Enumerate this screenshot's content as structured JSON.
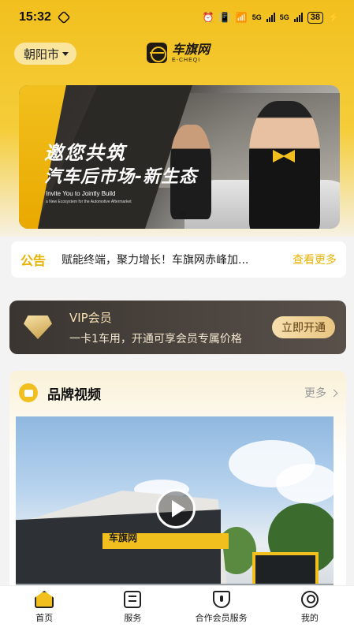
{
  "status_bar": {
    "time": "15:32",
    "network_5g_a": "5G",
    "network_5g_b": "5G",
    "battery": "38",
    "icons": [
      "alarm-icon",
      "vibrate-icon",
      "wifi-icon",
      "signal-icon",
      "signal-icon",
      "charging-icon"
    ]
  },
  "header": {
    "city": "朝阳市",
    "logo_cn": "车旗网",
    "logo_en": "E-CHEQI"
  },
  "banner": {
    "title_line1": "邀您共筑",
    "title_line2": "汽车后市场-新生态",
    "subtitle_en": "Invite You to Jointly Build",
    "subtitle_en_small": "a New Ecosystem for the Automotive Aftermarket"
  },
  "notice": {
    "tag": "公告",
    "text": "赋能终端，聚力增长！车旗网赤峰加...",
    "more": "查看更多"
  },
  "vip": {
    "title": "VIP会员",
    "desc": "一卡1车用，开通可享会员专属价格",
    "button": "立即开通"
  },
  "brand_video": {
    "title": "品牌视频",
    "more": "更多",
    "store_sign": "车旗网"
  },
  "tabbar": {
    "items": [
      {
        "label": "首页",
        "icon": "home-icon",
        "active": true
      },
      {
        "label": "服务",
        "icon": "service-icon",
        "active": false
      },
      {
        "label": "合作会员服务",
        "icon": "shield-icon",
        "active": false
      },
      {
        "label": "我的",
        "icon": "user-icon",
        "active": false
      }
    ]
  },
  "colors": {
    "brand_yellow": "#f2c01e",
    "accent_text": "#e8b200",
    "vip_dark": "#3a3531",
    "vip_gold": "#e9c581"
  }
}
